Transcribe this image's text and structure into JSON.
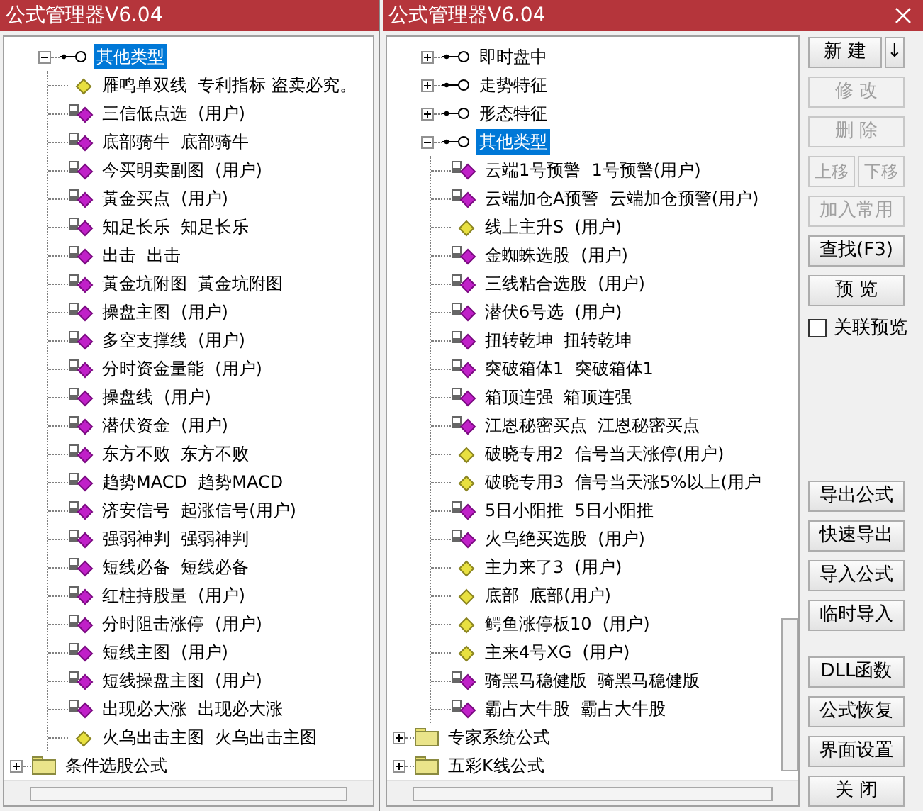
{
  "windows": [
    {
      "title": "公式管理器V6.04",
      "tree": [
        {
          "kind": "category",
          "label": "其他类型",
          "expanded": true,
          "selected": true,
          "children": [
            {
              "kind": "formula",
              "label": "雁鸣单双线  专利指标 盗卖必究。",
              "locked": false
            },
            {
              "kind": "formula",
              "label": "三信低点选  (用户)",
              "locked": true
            },
            {
              "kind": "formula",
              "label": "底部骑牛  底部骑牛",
              "locked": true
            },
            {
              "kind": "formula",
              "label": "今买明卖副图  (用户)",
              "locked": true
            },
            {
              "kind": "formula",
              "label": "黃金买点  (用户)",
              "locked": true
            },
            {
              "kind": "formula",
              "label": "知足长乐  知足长乐",
              "locked": true
            },
            {
              "kind": "formula",
              "label": "出击  出击",
              "locked": true
            },
            {
              "kind": "formula",
              "label": "黃金坑附图  黃金坑附图",
              "locked": true
            },
            {
              "kind": "formula",
              "label": "操盘主图  (用户)",
              "locked": true
            },
            {
              "kind": "formula",
              "label": "多空支撑线  (用户)",
              "locked": true
            },
            {
              "kind": "formula",
              "label": "分时资金量能  (用户)",
              "locked": true
            },
            {
              "kind": "formula",
              "label": "操盘线  (用户)",
              "locked": true
            },
            {
              "kind": "formula",
              "label": "潜伏资金  (用户)",
              "locked": true
            },
            {
              "kind": "formula",
              "label": "东方不败  东方不败",
              "locked": true
            },
            {
              "kind": "formula",
              "label": "趋势MACD  趋势MACD",
              "locked": true
            },
            {
              "kind": "formula",
              "label": "济安信号  起涨信号(用户)",
              "locked": true
            },
            {
              "kind": "formula",
              "label": "强弱神判  强弱神判",
              "locked": true
            },
            {
              "kind": "formula",
              "label": "短线必备  短线必备",
              "locked": true
            },
            {
              "kind": "formula",
              "label": "红柱持股量  (用户)",
              "locked": true
            },
            {
              "kind": "formula",
              "label": "分时阻击涨停  (用户)",
              "locked": true
            },
            {
              "kind": "formula",
              "label": "短线主图  (用户)",
              "locked": true
            },
            {
              "kind": "formula",
              "label": "短线操盘主图  (用户)",
              "locked": true
            },
            {
              "kind": "formula",
              "label": "出现必大涨  出现必大涨",
              "locked": true
            },
            {
              "kind": "formula",
              "label": "火乌出击主图  火乌出击主图",
              "locked": false
            }
          ]
        },
        {
          "kind": "folder",
          "label": "条件选股公式",
          "expanded": false,
          "selected": false
        }
      ]
    },
    {
      "title": "公式管理器V6.04",
      "tree": [
        {
          "kind": "category",
          "label": "即时盘中",
          "expanded": false,
          "selected": false
        },
        {
          "kind": "category",
          "label": "走势特征",
          "expanded": false,
          "selected": false
        },
        {
          "kind": "category",
          "label": "形态特征",
          "expanded": false,
          "selected": false
        },
        {
          "kind": "category",
          "label": "其他类型",
          "expanded": true,
          "selected": true,
          "children": [
            {
              "kind": "formula",
              "label": "云端1号预警  1号预警(用户)",
              "locked": true
            },
            {
              "kind": "formula",
              "label": "云端加仓A预警  云端加仓预警(用户)",
              "locked": true
            },
            {
              "kind": "formula",
              "label": "线上主升S  (用户)",
              "locked": false
            },
            {
              "kind": "formula",
              "label": "金蜘蛛选股  (用户)",
              "locked": true
            },
            {
              "kind": "formula",
              "label": "三线粘合选股  (用户)",
              "locked": true
            },
            {
              "kind": "formula",
              "label": "潜伏6号选  (用户)",
              "locked": true
            },
            {
              "kind": "formula",
              "label": "扭转乾坤  扭转乾坤",
              "locked": true
            },
            {
              "kind": "formula",
              "label": "突破箱体1  突破箱体1",
              "locked": true
            },
            {
              "kind": "formula",
              "label": "箱顶连强  箱顶连强",
              "locked": true
            },
            {
              "kind": "formula",
              "label": "江恩秘密买点  江恩秘密买点",
              "locked": true
            },
            {
              "kind": "formula",
              "label": "破晓专用2  信号当天涨停(用户)",
              "locked": false
            },
            {
              "kind": "formula",
              "label": "破晓专用3  信号当天涨5%以上(用户",
              "locked": false
            },
            {
              "kind": "formula",
              "label": "5日小阳推  5日小阳推",
              "locked": true
            },
            {
              "kind": "formula",
              "label": "火乌绝买选股  (用户)",
              "locked": true
            },
            {
              "kind": "formula",
              "label": "主力来了3  (用户)",
              "locked": false
            },
            {
              "kind": "formula",
              "label": "底部  底部(用户)",
              "locked": false
            },
            {
              "kind": "formula",
              "label": "鳄鱼涨停板10  (用户)",
              "locked": false
            },
            {
              "kind": "formula",
              "label": "主来4号XG  (用户)",
              "locked": false
            },
            {
              "kind": "formula",
              "label": "骑黑马稳健版  骑黑马稳健版",
              "locked": true
            },
            {
              "kind": "formula",
              "label": "霸占大牛股  霸占大牛股",
              "locked": true
            }
          ]
        },
        {
          "kind": "folder",
          "label": "专家系统公式",
          "expanded": false,
          "selected": false
        },
        {
          "kind": "folder",
          "label": "五彩K线公式",
          "expanded": false,
          "selected": false
        }
      ]
    }
  ],
  "button_groups": [
    [
      {
        "kind": "split",
        "label": "新 建",
        "arrow": "↓",
        "disabled": false
      },
      {
        "kind": "button",
        "label": "修 改",
        "disabled": true
      },
      {
        "kind": "button",
        "label": "删 除",
        "disabled": true
      },
      {
        "kind": "pair",
        "buttons": [
          {
            "label": "上移",
            "disabled": true
          },
          {
            "label": "下移",
            "disabled": true
          }
        ]
      },
      {
        "kind": "button",
        "label": "加入常用",
        "disabled": true
      },
      {
        "kind": "button",
        "label": "查找(F3)",
        "disabled": false
      },
      {
        "kind": "button",
        "label": "预 览",
        "disabled": false
      },
      {
        "kind": "checkbox",
        "label": "关联预览",
        "checked": false
      }
    ],
    [
      {
        "kind": "button",
        "label": "导出公式",
        "disabled": false
      },
      {
        "kind": "button",
        "label": "快速导出",
        "disabled": false
      },
      {
        "kind": "button",
        "label": "导入公式",
        "disabled": false
      },
      {
        "kind": "button",
        "label": "临时导入",
        "disabled": false
      }
    ],
    [
      {
        "kind": "button",
        "label": "DLL函数",
        "disabled": false
      },
      {
        "kind": "button",
        "label": "公式恢复",
        "disabled": false
      },
      {
        "kind": "button",
        "label": "界面设置",
        "disabled": false
      },
      {
        "kind": "button",
        "label": "关 闭",
        "disabled": false
      }
    ]
  ]
}
